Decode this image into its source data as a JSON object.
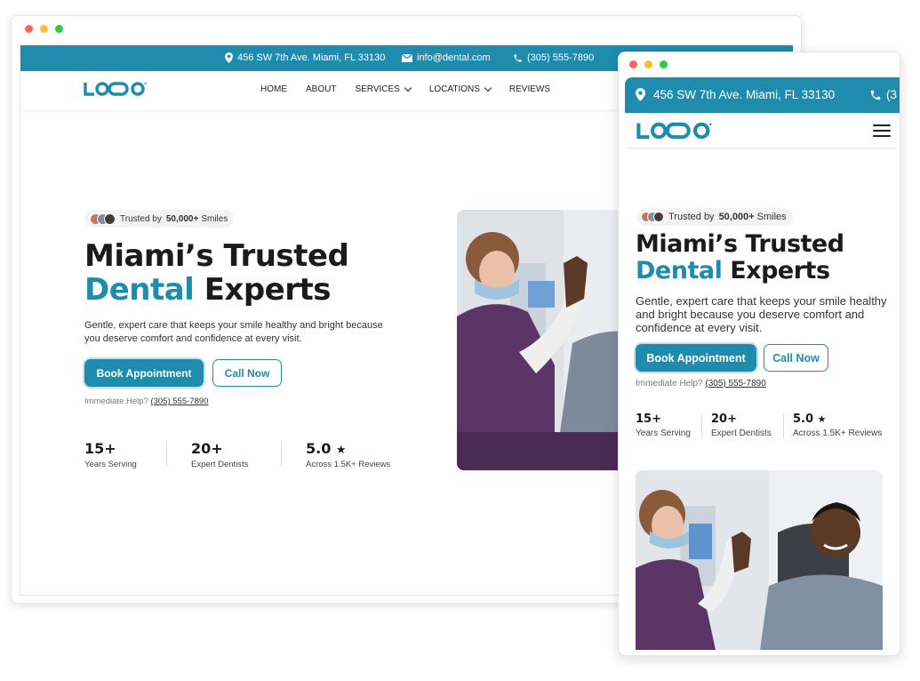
{
  "contact": {
    "address": "456 SW 7th Ave. Miami, FL 33130",
    "email": "info@dental.com",
    "phone": "(305) 555-7890",
    "mobile_phone_partial": "(3"
  },
  "brand": {
    "logo_text": "LOQO",
    "accent": "#1f8cae",
    "dark": "#1b1b1b"
  },
  "nav": {
    "items": [
      {
        "label": "HOME",
        "dropdown": false
      },
      {
        "label": "ABOUT",
        "dropdown": false
      },
      {
        "label": "SERVICES",
        "dropdown": true
      },
      {
        "label": "LOCATIONS",
        "dropdown": true
      },
      {
        "label": "REVIEWS",
        "dropdown": false
      }
    ]
  },
  "hero": {
    "badge_prefix": "Trusted by",
    "badge_count": "50,000+",
    "badge_suffix": "Smiles",
    "title_line1": "Miami’s Trusted",
    "title_accent": "Dental",
    "title_rest": "Experts",
    "subtitle": "Gentle, expert care that keeps your smile healthy and bright because you deserve comfort and confidence at every visit.",
    "primary_cta": "Book Appointment",
    "secondary_cta": "Call Now",
    "help_text": "Immediate Help?",
    "help_phone": "(305) 555-7890"
  },
  "stats": [
    {
      "value": "15+",
      "label": "Years Serving",
      "star": false
    },
    {
      "value": "20+",
      "label": "Expert Dentists",
      "star": false
    },
    {
      "value": "5.0",
      "label": "Across 1.5K+ Reviews",
      "star": true
    }
  ],
  "icons": {
    "location": "map-pin-icon",
    "email": "mail-icon",
    "phone": "phone-icon",
    "menu": "hamburger-menu-icon",
    "star": "star-icon"
  }
}
